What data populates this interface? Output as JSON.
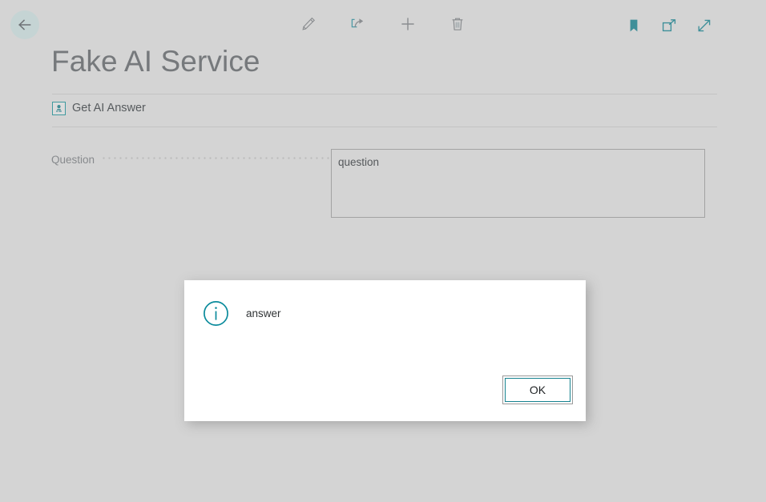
{
  "window": {
    "background_color": "#d4d4d4",
    "accent_color": "#16828f"
  },
  "topbar": {
    "back_label": "Back",
    "center_actions": [
      {
        "name": "edit",
        "label": "Edit",
        "icon": "pencil-icon"
      },
      {
        "name": "share",
        "label": "Share",
        "icon": "share-icon"
      },
      {
        "name": "new",
        "label": "New",
        "icon": "plus-icon"
      },
      {
        "name": "delete",
        "label": "Delete",
        "icon": "trash-icon"
      }
    ],
    "right_actions": [
      {
        "name": "bookmark",
        "label": "Bookmark",
        "icon": "bookmark-icon"
      },
      {
        "name": "open-in-new-window",
        "label": "Open in new window",
        "icon": "open-new-window-icon"
      },
      {
        "name": "expand",
        "label": "Expand",
        "icon": "expand-icon"
      }
    ]
  },
  "header": {
    "title": "Fake AI Service"
  },
  "actions": {
    "get_ai_answer": {
      "label": "Get AI Answer",
      "icon": "ai-action-icon"
    }
  },
  "form": {
    "fields": [
      {
        "label": "Question",
        "value": "question",
        "placeholder": ""
      }
    ]
  },
  "dialog": {
    "visible": true,
    "icon": "info-icon",
    "message": "answer",
    "ok_label": "OK"
  }
}
